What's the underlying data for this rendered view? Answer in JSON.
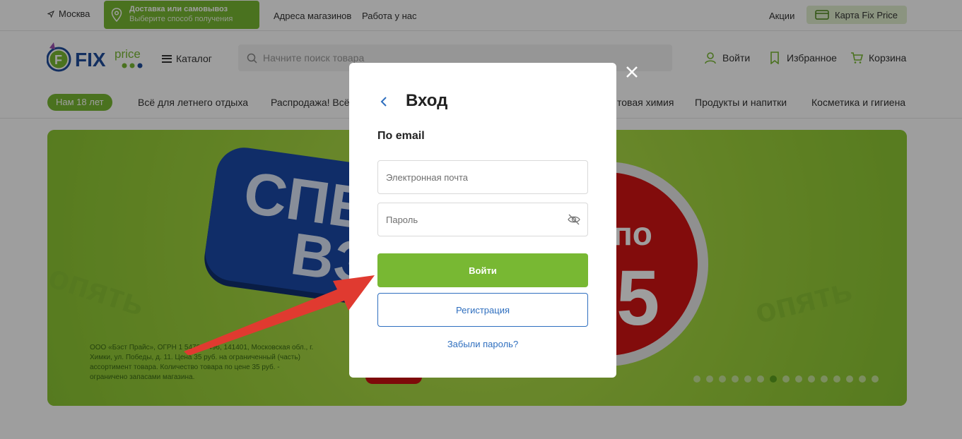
{
  "topbar": {
    "city": "Москва",
    "delivery_title": "Доставка или самовывоз",
    "delivery_sub": "Выберите способ получения",
    "links": [
      "Адреса магазинов",
      "Работа у нас"
    ],
    "promo": "Акции",
    "card": "Карта Fix Price"
  },
  "header": {
    "logo_text": "FIX price",
    "catalog": "Каталог",
    "search_placeholder": "Начните поиск товара",
    "login": "Войти",
    "favorites": "Избранное",
    "cart": "Корзина"
  },
  "categories": {
    "badge": "Нам 18 лет",
    "items": [
      "Всё для летнего отдыха",
      "Распродажа! Всё",
      "товая химия",
      "Продукты и напитки",
      "Косметика и гигиена"
    ]
  },
  "banner": {
    "big1": "СПЕ",
    "big2": "ВЭ",
    "by": "по",
    "num": "5",
    "opyat": "опять",
    "legal": "ООО «Бэст Прайс», ОГРН 1 547007496, 141401, Московская обл., г. Химки, ул. Победы, д. 11. Цена 35 руб. на ограниченный (часть) ассортимент товара. Количество товара по цене 35 руб. - ограничено запасами магазина.",
    "dots_count": 15,
    "active_dot": 6
  },
  "modal": {
    "title": "Вход",
    "subtitle": "По email",
    "email_placeholder": "Электронная почта",
    "password_placeholder": "Пароль",
    "login_button": "Войти",
    "register_button": "Регистрация",
    "forgot_link": "Забыли пароль?"
  },
  "colors": {
    "brand_green": "#78b833",
    "link_blue": "#2f6fbf",
    "annotation_red": "#e03a30"
  }
}
